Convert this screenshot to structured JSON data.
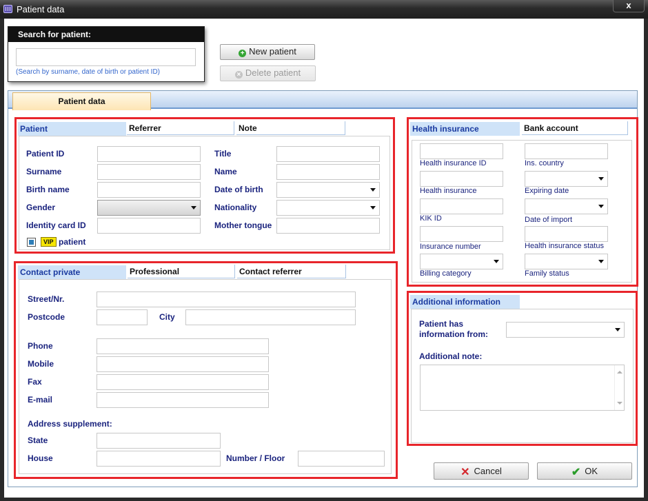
{
  "window": {
    "title": "Patient data",
    "close_label": "x"
  },
  "search": {
    "header": "Search for patient:",
    "value": "",
    "hint": "(Search by surname, date of birth or patient ID)"
  },
  "actions": {
    "new_patient": "New patient",
    "delete_patient": "Delete patient"
  },
  "main_tab": "Patient data",
  "patient_section": {
    "tabs": [
      "Patient",
      "Referrer",
      "Note"
    ],
    "labels": {
      "patient_id": "Patient ID",
      "surname": "Surname",
      "birth_name": "Birth name",
      "gender": "Gender",
      "identity_card_id": "Identity card ID",
      "title": "Title",
      "name": "Name",
      "date_of_birth": "Date of birth",
      "nationality": "Nationality",
      "mother_tongue": "Mother tongue"
    },
    "vip_badge": "VIP",
    "vip_label": "patient",
    "vip_checked": true
  },
  "contact_section": {
    "tabs": [
      "Contact private",
      "Professional",
      "Contact referrer"
    ],
    "labels": {
      "street": "Street/Nr.",
      "postcode": "Postcode",
      "city": "City",
      "phone": "Phone",
      "mobile": "Mobile",
      "fax": "Fax",
      "email": "E-mail",
      "address_supplement": "Address supplement:",
      "state": "State",
      "house": "House",
      "number_floor": "Number / Floor"
    }
  },
  "insurance_section": {
    "tabs": [
      "Health insurance",
      "Bank account"
    ],
    "labels": {
      "health_insurance_id": "Health insurance ID",
      "ins_country": "Ins. country",
      "health_insurance": "Health insurance",
      "expiring_date": "Expiring date",
      "kik_id": "KIK ID",
      "date_of_import": "Date of import",
      "insurance_number": "Insurance number",
      "health_insurance_status": "Health insurance status",
      "billing_category": "Billing category",
      "family_status": "Family status"
    }
  },
  "additional_section": {
    "tab": "Additional information",
    "info_from_label_1": "Patient has",
    "info_from_label_2": "information from:",
    "note_label": "Additional note:"
  },
  "footer": {
    "cancel": "Cancel",
    "ok": "OK"
  },
  "colors": {
    "highlight_border": "#e8252b",
    "label_text": "#1a237e",
    "active_subtab": "#cfe3f8",
    "main_tab": "#fde5b4"
  }
}
